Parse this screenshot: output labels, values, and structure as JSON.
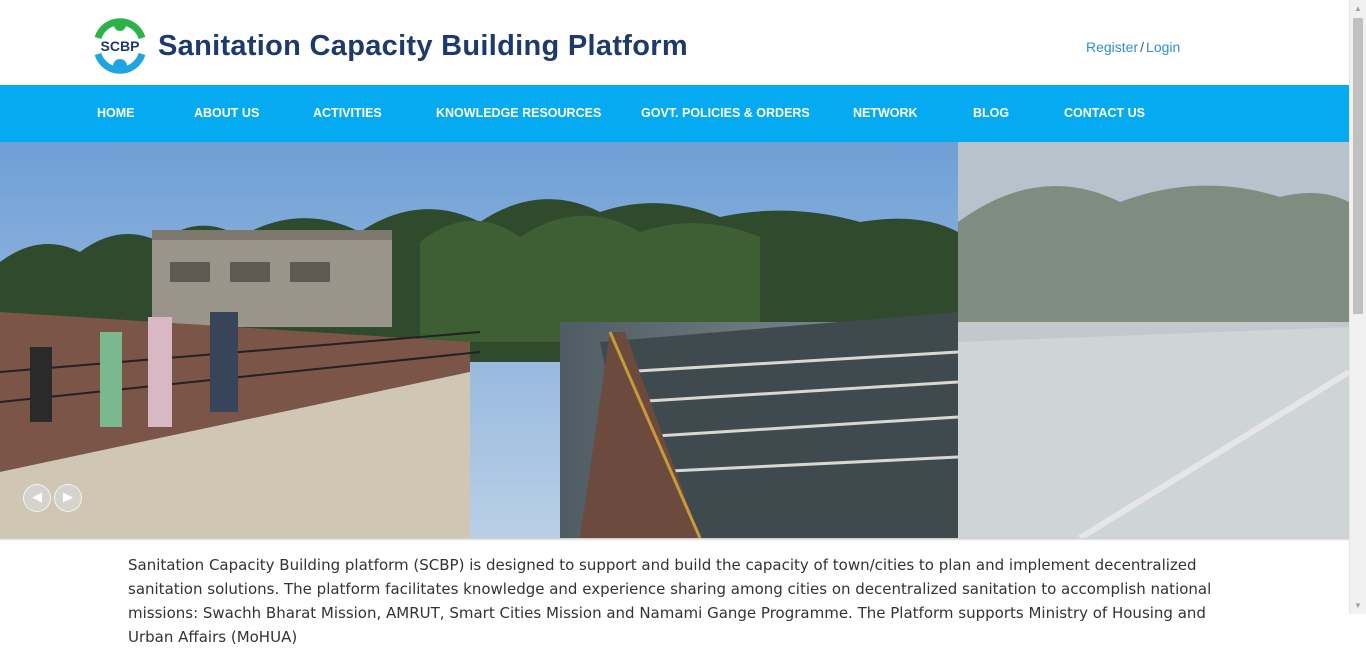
{
  "header": {
    "logo_text": "SCBP",
    "site_title": "Sanitation Capacity Building Platform",
    "register_label": "Register",
    "separator": "/",
    "login_label": "Login"
  },
  "nav": {
    "items": [
      {
        "label": "HOME"
      },
      {
        "label": "ABOUT US"
      },
      {
        "label": "ACTIVITIES"
      },
      {
        "label": "KNOWLEDGE RESOURCES"
      },
      {
        "label": "GOVT. POLICIES & ORDERS"
      },
      {
        "label": "NETWORK"
      },
      {
        "label": "BLOG"
      },
      {
        "label": "CONTACT US"
      }
    ]
  },
  "slider": {
    "prev_icon": "chevron-left-icon",
    "next_icon": "chevron-right-icon"
  },
  "main": {
    "intro_text": "Sanitation Capacity Building platform (SCBP) is designed to support and build the capacity of town/cities to plan and implement decentralized sanitation solutions. The platform facilitates knowledge and experience sharing among cities on decentralized sanitation to accomplish national missions: Swachh Bharat Mission, AMRUT, Smart Cities Mission and Namami Gange Programme. The Platform supports Ministry of Housing and Urban Affairs (MoHUA)"
  },
  "colors": {
    "nav_background": "#05aaf0",
    "title_color": "#1c3a6b",
    "logo_green": "#2bb34a",
    "logo_blue": "#1ea4e0",
    "link_color": "#2f8fd0"
  }
}
